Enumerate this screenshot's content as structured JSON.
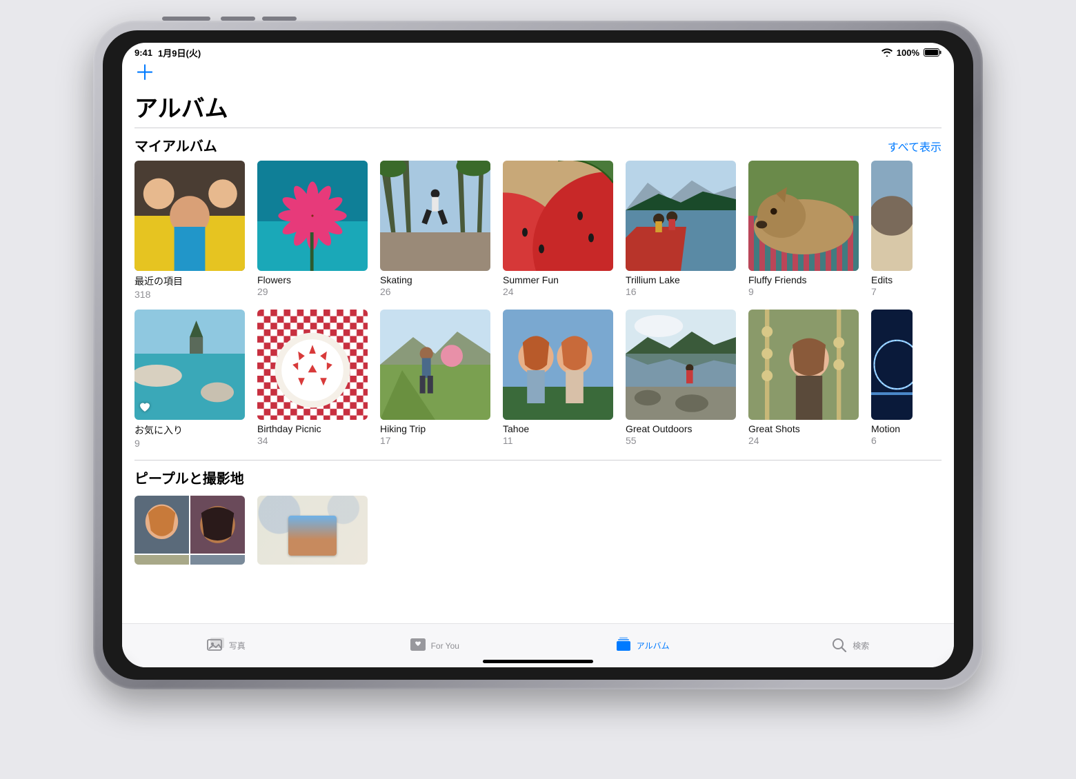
{
  "status": {
    "time": "9:41",
    "date": "1月9日(火)",
    "battery_pct": "100%"
  },
  "nav": {
    "page_title": "アルバム"
  },
  "sections": {
    "my_albums": {
      "title": "マイアルバム",
      "see_all": "すべて表示",
      "row1": [
        {
          "name": "最近の項目",
          "count": "318"
        },
        {
          "name": "Flowers",
          "count": "29"
        },
        {
          "name": "Skating",
          "count": "26"
        },
        {
          "name": "Summer Fun",
          "count": "24"
        },
        {
          "name": "Trillium Lake",
          "count": "16"
        },
        {
          "name": "Fluffy Friends",
          "count": "9"
        },
        {
          "name": "Edits",
          "count": "7"
        }
      ],
      "row2": [
        {
          "name": "お気に入り",
          "count": "9",
          "favorite": true
        },
        {
          "name": "Birthday Picnic",
          "count": "34"
        },
        {
          "name": "Hiking Trip",
          "count": "17"
        },
        {
          "name": "Tahoe",
          "count": "11"
        },
        {
          "name": "Great Outdoors",
          "count": "55"
        },
        {
          "name": "Great Shots",
          "count": "24"
        },
        {
          "name": "Motion",
          "count": "6"
        }
      ]
    },
    "people_places": {
      "title": "ピープルと撮影地"
    }
  },
  "tabs": {
    "photos": "写真",
    "for_you": "For You",
    "albums": "アルバム",
    "search": "検索"
  },
  "colors": {
    "accent": "#007aff",
    "muted": "#8e8e93"
  }
}
